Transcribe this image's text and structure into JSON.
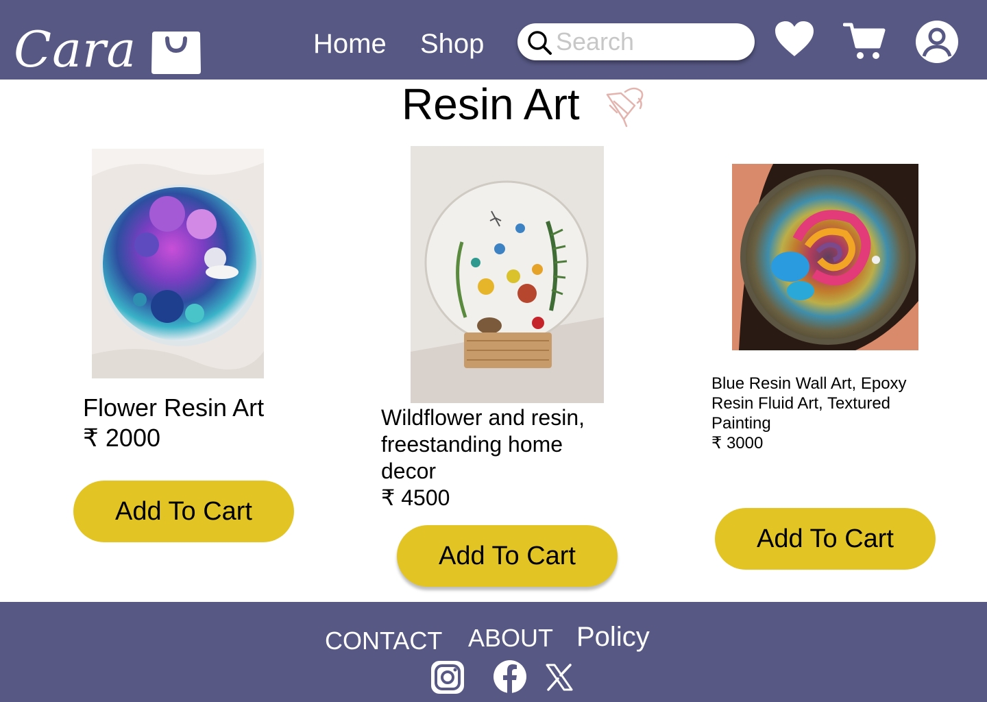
{
  "header": {
    "logo_text": "Cara",
    "nav": [
      {
        "label": "Home"
      },
      {
        "label": "Shop"
      }
    ],
    "search": {
      "placeholder": "Search",
      "value": ""
    },
    "icons": [
      "heart-icon",
      "cart-icon",
      "user-icon"
    ]
  },
  "page": {
    "title": "Resin Art",
    "title_icon": "resin-brush-icon"
  },
  "products": [
    {
      "name": "Flower Resin Art",
      "price": "₹ 2000",
      "button": "Add To Cart"
    },
    {
      "name": "Wildflower and resin, freestanding home decor",
      "price": "₹ 4500",
      "button": "Add To Cart"
    },
    {
      "name": "Blue Resin Wall Art, Epoxy Resin Fluid Art, Textured Painting",
      "price": "₹ 3000",
      "button": "Add To Cart"
    }
  ],
  "footer": {
    "links": [
      {
        "label": "CONTACT"
      },
      {
        "label": "ABOUT"
      },
      {
        "label": "Policy"
      }
    ],
    "social": [
      "instagram-icon",
      "facebook-icon",
      "x-icon"
    ]
  },
  "colors": {
    "header_bg": "#575884",
    "button_bg": "#e2c424",
    "text": "#000000"
  }
}
